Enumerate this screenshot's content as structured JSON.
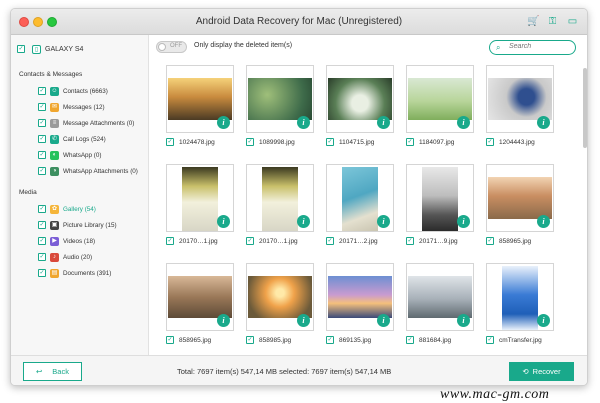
{
  "window": {
    "title": "Android Data Recovery for Mac (Unregistered)"
  },
  "sidebar": {
    "device": "GALAXY S4",
    "section1": "Contacts & Messages",
    "section2": "Media",
    "contacts_items": [
      {
        "label": "Contacts (6663)",
        "color": "#19a98b",
        "icon": "contact-icon",
        "glyph": "☺"
      },
      {
        "label": "Messages (12)",
        "color": "#f0a62f",
        "icon": "message-icon",
        "glyph": "✉"
      },
      {
        "label": "Message Attachments (0)",
        "color": "#9a9a9a",
        "icon": "attachment-icon",
        "glyph": "≡"
      },
      {
        "label": "Call Logs (524)",
        "color": "#19a98b",
        "icon": "phone-icon",
        "glyph": "✆"
      },
      {
        "label": "WhatsApp (0)",
        "color": "#25c25c",
        "icon": "whatsapp-icon",
        "glyph": "◐"
      },
      {
        "label": "WhatsApp Attachments (0)",
        "color": "#3d8f60",
        "icon": "whatsapp-attachment-icon",
        "glyph": "◑"
      }
    ],
    "media_items": [
      {
        "label": "Gallery (54)",
        "color": "#f5b53a",
        "icon": "gallery-icon",
        "glyph": "✿",
        "selected": true
      },
      {
        "label": "Picture Library (15)",
        "color": "#444444",
        "icon": "picture-icon",
        "glyph": "▣"
      },
      {
        "label": "Videos (18)",
        "color": "#7b5ed6",
        "icon": "video-icon",
        "glyph": "▶"
      },
      {
        "label": "Audio (20)",
        "color": "#d9493b",
        "icon": "audio-icon",
        "glyph": "♪"
      },
      {
        "label": "Documents (391)",
        "color": "#f0a62f",
        "icon": "document-icon",
        "glyph": "▤"
      }
    ]
  },
  "filter": {
    "toggle": "OFF",
    "label": "Only display the deleted item(s)"
  },
  "search": {
    "placeholder": "Search"
  },
  "photos": [
    {
      "name": "1024478.jpg",
      "tall": false,
      "bg": "linear-gradient(180deg,#f5d27a 0%,#c98b3e 45%,#4b3a24 100%)"
    },
    {
      "name": "1089998.jpg",
      "tall": false,
      "bg": "radial-gradient(circle at 30% 40%,#9fbf7a,#3e6b4a 70%,#2a4a34)"
    },
    {
      "name": "1104715.jpg",
      "tall": false,
      "bg": "radial-gradient(circle at 50% 60%,#e9efe3 20%,#5a7f56 60%,#2a3d2a)"
    },
    {
      "name": "1184097.jpg",
      "tall": false,
      "bg": "linear-gradient(180deg,#d9e8d3 0%,#b8d59a 55%,#7fae5c 100%)"
    },
    {
      "name": "1204443.jpg",
      "tall": false,
      "bg": "radial-gradient(circle at 60% 45%,#2f4f8f 18%,#c9c9c9 45%,#e6e6e6)"
    },
    {
      "name": "20170…1.jpg",
      "tall": true,
      "bg": "linear-gradient(180deg,#3b3a20 0%,#c9c06a 30%,#f2f0dc 55%,#d8d6c6 100%)"
    },
    {
      "name": "20170…1.jpg",
      "tall": true,
      "bg": "linear-gradient(180deg,#3b3a20 0%,#c9c06a 30%,#f2f0dc 55%,#d8d6c6 100%)"
    },
    {
      "name": "20171…2.jpg",
      "tall": true,
      "bg": "linear-gradient(160deg,#7cc6d9 0%,#4fa7c2 45%,#e4e0cf 75%,#c9c4b0 100%)"
    },
    {
      "name": "20171…9.jpg",
      "tall": true,
      "bg": "linear-gradient(180deg,#e8e8e8 0%,#bdbdbd 45%,#555 75%,#2b2b2b 100%)"
    },
    {
      "name": "858965.jpg",
      "tall": false,
      "bg": "linear-gradient(180deg,#f2d4b3 0%,#c98e62 45%,#8a6a4a 100%)"
    },
    {
      "name": "858965.jpg",
      "tall": false,
      "bg": "linear-gradient(180deg,#d8b897 0%,#9a7858 50%,#5d4a37 100%)"
    },
    {
      "name": "858985.jpg",
      "tall": false,
      "bg": "radial-gradient(circle at 50% 40%,#ffe9a8 10%,#f0a24a 35%,#6b5a3a 80%)"
    },
    {
      "name": "869135.jpg",
      "tall": false,
      "bg": "linear-gradient(180deg,#6d8fd2 0%,#c99bd0 45%,#f4c07c 65%,#3b4a7a 100%)"
    },
    {
      "name": "881684.jpg",
      "tall": false,
      "bg": "linear-gradient(180deg,#dfe4e8 0%,#a7b0b8 55%,#5f6a70 100%)"
    },
    {
      "name": "cmTransfer.jpg",
      "tall": true,
      "bg": "linear-gradient(180deg,#e9f1fb 0%,#3a7bd5 45%,#1f5fb8 75%,#e9f1fb 100%)"
    }
  ],
  "footer": {
    "back": "Back",
    "summary": "Total: 7697 item(s) 547,14 MB   selected: 7697 item(s) 547,14 MB",
    "recover": "Recover"
  },
  "watermark": "www.mac-gm.com"
}
